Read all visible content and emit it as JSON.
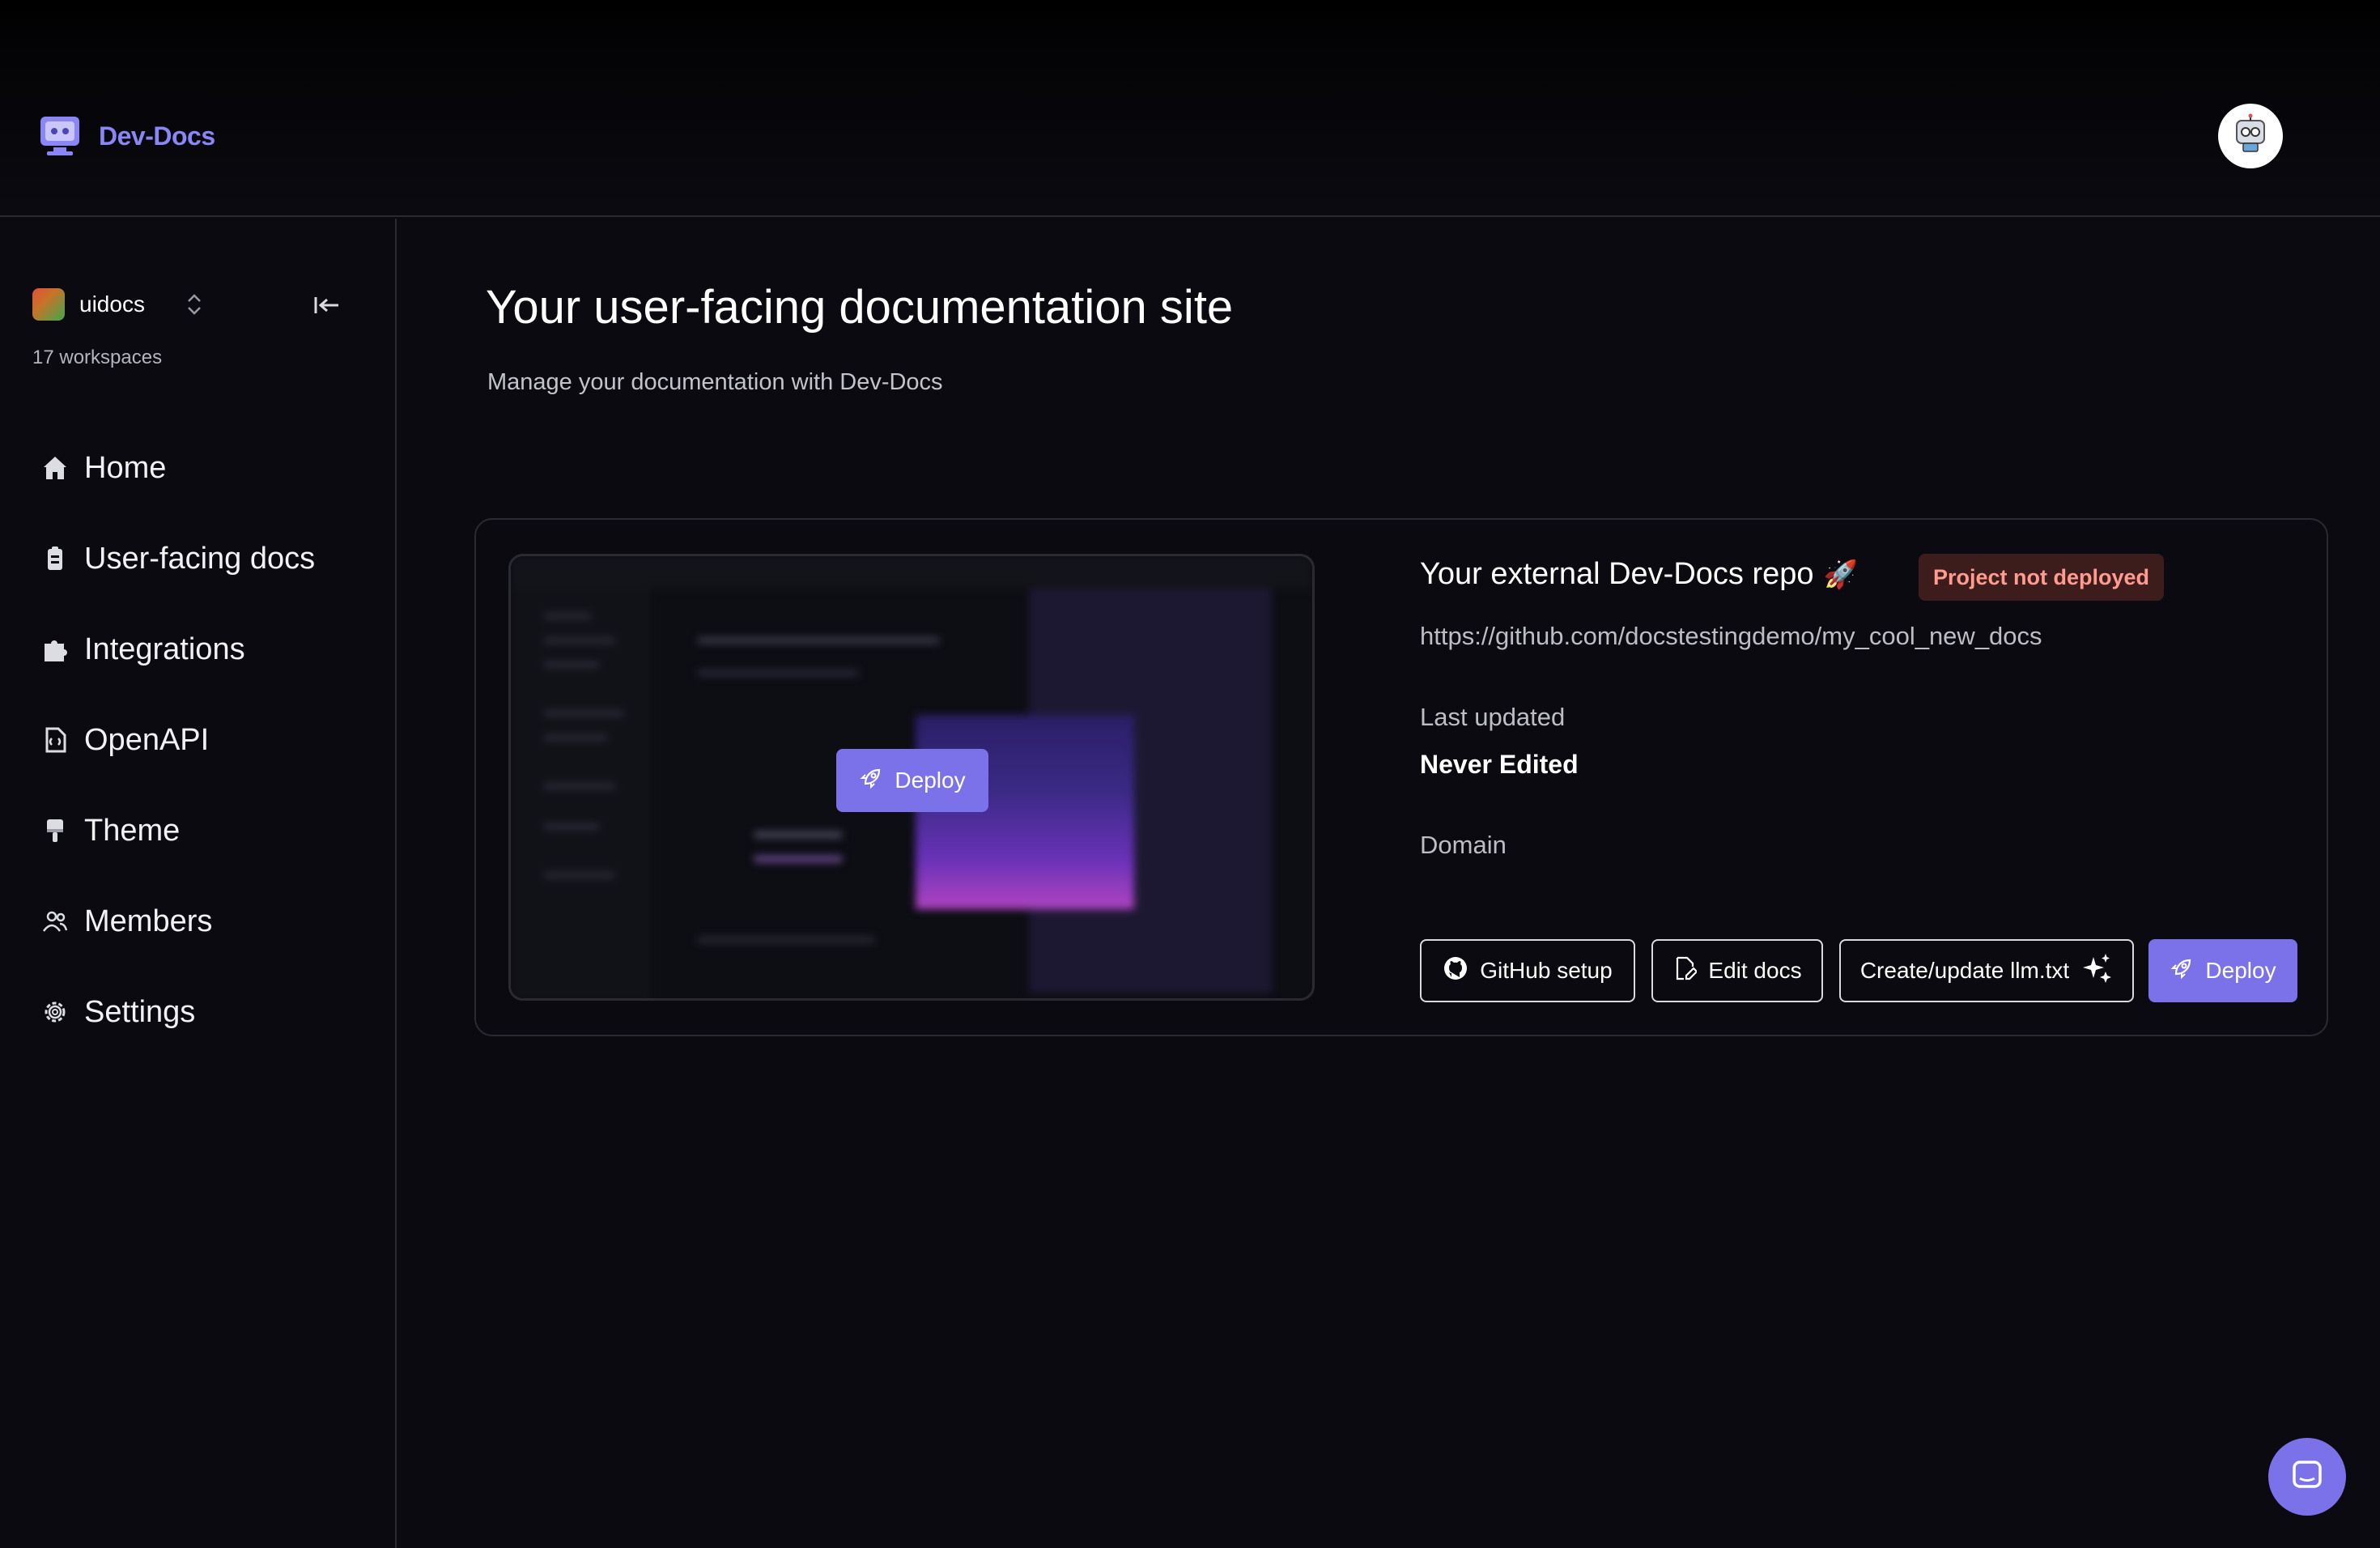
{
  "app": {
    "brand": "Dev-Docs",
    "brand_color": "#8b86f5",
    "accent": "#7b72e9"
  },
  "header": {
    "logo_icon": "robot-monitor-icon",
    "avatar_icon": "robot-avatar-icon"
  },
  "workspace": {
    "name": "uidocs",
    "count_label": "17 workspaces"
  },
  "nav": {
    "items": [
      {
        "label": "Home",
        "icon": "home-icon"
      },
      {
        "label": "User-facing docs",
        "icon": "docs-icon"
      },
      {
        "label": "Integrations",
        "icon": "puzzle-icon"
      },
      {
        "label": "OpenAPI",
        "icon": "api-file-icon"
      },
      {
        "label": "Theme",
        "icon": "paint-brush-icon"
      },
      {
        "label": "Members",
        "icon": "users-icon"
      },
      {
        "label": "Settings",
        "icon": "gear-icon"
      }
    ]
  },
  "main": {
    "title": "Your user-facing documentation site",
    "subtitle": "Manage your documentation with Dev-Docs"
  },
  "card": {
    "preview_deploy_label": "Deploy",
    "repo_title": "Your external Dev-Docs repo",
    "repo_emoji": "🚀",
    "status_badge": "Project not deployed",
    "repo_url": "https://github.com/docstestingdemo/my_cool_new_docs",
    "last_updated_label": "Last updated",
    "last_updated_value": "Never Edited",
    "domain_label": "Domain",
    "buttons": {
      "github": "GitHub setup",
      "edit": "Edit docs",
      "llm": "Create/update llm.txt",
      "deploy": "Deploy"
    }
  },
  "chat": {
    "icon": "chat-icon"
  }
}
